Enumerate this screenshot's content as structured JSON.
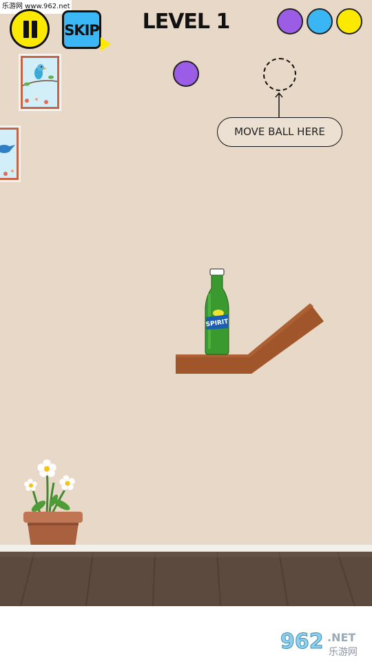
{
  "watermark": {
    "top_text": "乐游网 www.962.net",
    "bottom_main": "962",
    "bottom_suffix": ".NET",
    "bottom_sub": "乐游网"
  },
  "header": {
    "pause_icon": "pause-icon",
    "skip_label": "SKIP",
    "level_title": "LEVEL 1",
    "balls_remaining": [
      {
        "color": "#9b5de5"
      },
      {
        "color": "#3ab6f5"
      },
      {
        "color": "#fce900"
      }
    ]
  },
  "game": {
    "active_ball_color": "#9b5de5",
    "hint_text": "MOVE BALL HERE",
    "bottle_label": "SPIRIT"
  },
  "colors": {
    "wall": "#e7d8c7",
    "floor": "#5d4a3f",
    "shelf": "#a0552a",
    "bottle": "#3a9a2f",
    "pause_button": "#fce900",
    "skip_button": "#3cb7f5"
  }
}
